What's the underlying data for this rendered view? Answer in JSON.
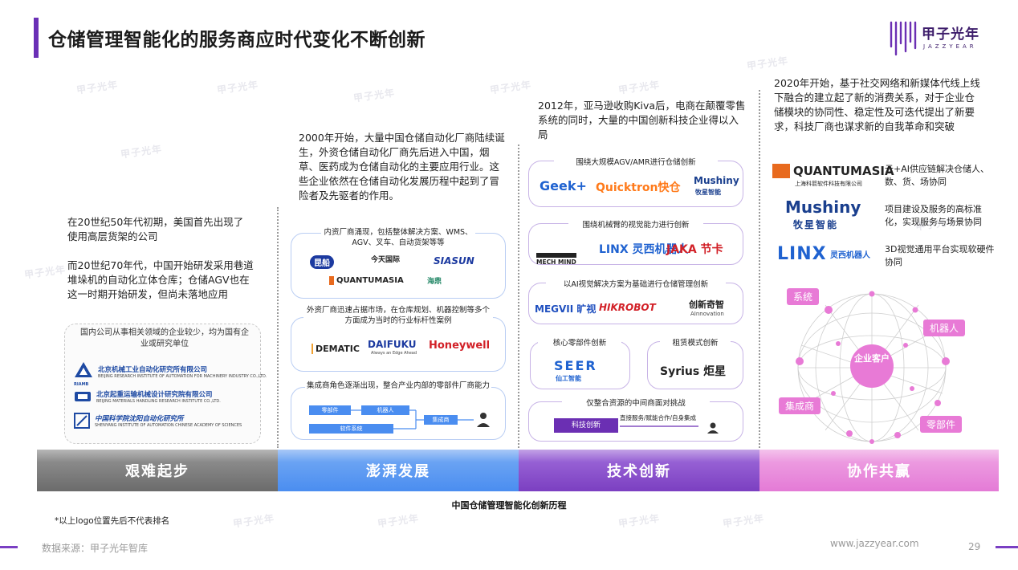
{
  "header": {
    "title": "仓储管理智能化的服务商应时代变化不断创新",
    "logo_name": "甲子光年",
    "logo_sub": "JAZZYEAR"
  },
  "watermark": "甲子光年",
  "stage1": {
    "text1": "在20世纪50年代初期，美国首先出现了使用高层货架的公司",
    "text2": "而20世纪70年代，中国开始研发采用巷道堆垛机的自动化立体仓库；仓储AGV也在这一时期开始研发，但尚未落地应用",
    "box_title": "国内公司从事相关领域的企业较少，均为国有企业或研究单位",
    "institutions": [
      {
        "name": "北京机械工业自动化研究所有限公司",
        "sub": "BEIJING RESEARCH INSTITUTE OF AUTOMATION FOR MACHINERY INDUSTRY CO.,LTD.",
        "logo": "RIAMB"
      },
      {
        "name": "北京起重运输机械设计研究院有限公司",
        "sub": "BEIJING MATERIALS HANDLING RESEARCH INSTITUTE CO.,LTD.",
        "logo": ""
      },
      {
        "name": "中国科学院沈阳自动化研究所",
        "sub": "SHENYANG INSTITUTE OF AUTOMATION CHINESE ACADEMY OF SCIENCES",
        "logo": ""
      }
    ]
  },
  "stage2": {
    "text": "2000年开始，大量中国仓储自动化厂商陆续诞生，外资仓储自动化厂商先后进入中国，烟草、医药成为仓储自动化的主要应用行业。这些企业依然在仓储自动化发展历程中起到了冒险者及先驱者的作用。",
    "box1_caption": "内资厂商涌现，包括整体解决方案、WMS、AGV、叉车、自动货架等等",
    "box1_brands": [
      "昆船",
      "今天国际",
      "SIASUN",
      "QUANTUMASIA",
      "海鼎"
    ],
    "box2_caption": "外资厂商迅速占据市场，在仓库规划、机器控制等多个方面成为当时的行业标杆性案例",
    "box2_brands": [
      "DEMATIC",
      "DAIFUKU",
      "Honeywell"
    ],
    "daifuku_sub": "Always an Edge Ahead",
    "box3_caption": "集成商角色逐渐出现，整合产业内部的零部件厂商能力",
    "flow": [
      "零部件",
      "机器人",
      "集成商",
      "软件系统"
    ]
  },
  "stage3": {
    "text": "2012年，亚马逊收购Kiva后，电商在颠覆零售系统的同时，大量的中国创新科技企业得以入局",
    "box1_caption": "围绕大规模AGV/AMR进行仓储创新",
    "box1_brands": [
      "Geek+",
      "Quicktron快仓",
      "Mushiny",
      "牧星智能"
    ],
    "box2_caption": "围绕机械臂的视觉能力进行创新",
    "box2_brands": [
      "MECH MIND",
      "LINX 灵西机器人",
      "JAKA 节卡"
    ],
    "box3_caption": "以AI视觉解决方案为基础进行仓储管理创新",
    "box3_brands": [
      "MEGVII 旷视",
      "HIKROBOT",
      "创新奇智",
      "AInnovation"
    ],
    "box4_caption": "核心零部件创新",
    "box4_brands": [
      "SEER",
      "仙工智能"
    ],
    "box5_caption": "租赁模式创新",
    "box5_brands": [
      "Syrius 炬星"
    ],
    "box6_caption": "仅整合资源的中间商面对挑战",
    "box6_flow": [
      "科技创新",
      "直接服务/赋能合作/自身集成"
    ]
  },
  "stage4": {
    "text": "2020年开始，基于社交网络和新媒体代线上线下融合的建立起了新的消费关系，对于企业仓储模块的协同性、稳定性及可迭代提出了新要求，科技厂商也谋求新的自我革命和突破",
    "rows": [
      {
        "brand": "QUANTUMASIA",
        "brand_sub": "上海科箭软件科技有限公司",
        "desc": "云+AI供应链解决仓储人、数、货、场协同"
      },
      {
        "brand": "Mushiny",
        "brand_sub": "牧星智能",
        "desc": "项目建设及服务的高标准化，实现服务与场景协同"
      },
      {
        "brand": "LINX",
        "brand_sub": "灵西机器人",
        "desc": "3D视觉通用平台实现软硬件协同"
      }
    ],
    "tags": [
      "系统",
      "机器人",
      "集成商",
      "零部件"
    ],
    "center": "企业客户"
  },
  "timeline": {
    "stages": [
      "艰难起步",
      "澎湃发展",
      "技术创新",
      "协作共赢"
    ],
    "colors": [
      "#6b6b6b",
      "#4a8df0",
      "#7b3fc1",
      "#e47ad6"
    ],
    "caption": "中国仓储管理智能化创新历程"
  },
  "footnote": "*以上logo位置先后不代表排名",
  "footer": {
    "source": "数据来源：甲子光年智库",
    "site": "www.jazzyear.com",
    "page": "29"
  }
}
